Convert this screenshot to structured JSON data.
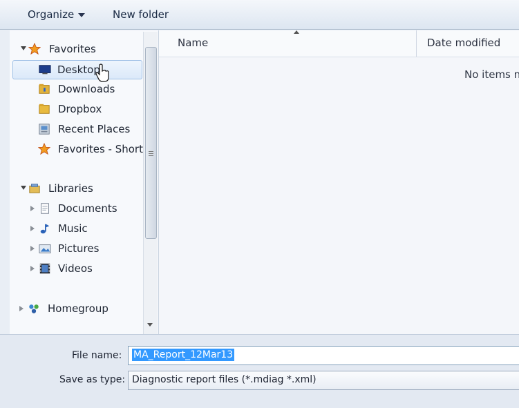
{
  "toolbar": {
    "organize_label": "Organize",
    "new_folder_label": "New folder"
  },
  "nav": {
    "favorites": {
      "label": "Favorites",
      "items": [
        {
          "label": "Desktop",
          "icon": "desktop-icon"
        },
        {
          "label": "Downloads",
          "icon": "downloads-folder-icon"
        },
        {
          "label": "Dropbox",
          "icon": "dropbox-folder-icon"
        },
        {
          "label": "Recent Places",
          "icon": "recent-places-icon"
        },
        {
          "label": "Favorites - Shortc",
          "icon": "favorites-star-icon"
        }
      ]
    },
    "libraries": {
      "label": "Libraries",
      "items": [
        {
          "label": "Documents",
          "icon": "documents-icon"
        },
        {
          "label": "Music",
          "icon": "music-icon"
        },
        {
          "label": "Pictures",
          "icon": "pictures-icon"
        },
        {
          "label": "Videos",
          "icon": "videos-icon"
        }
      ]
    },
    "homegroup": {
      "label": "Homegroup"
    }
  },
  "content": {
    "columns": {
      "name": "Name",
      "date_modified": "Date modified"
    },
    "empty_text": "No items n"
  },
  "bottom": {
    "file_name_label": "File name:",
    "file_name_value": "MA_Report_12Mar13",
    "save_type_label": "Save as type:",
    "save_type_value": "Diagnostic report files (*.mdiag *.xml)"
  },
  "colors": {
    "selection": "#3399ff",
    "accent": "#1a2a44"
  }
}
